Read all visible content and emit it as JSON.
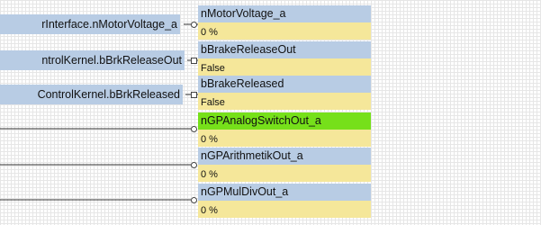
{
  "sources": [
    {
      "label": "rInterface.nMotorVoltage_a",
      "pin": "circle"
    },
    {
      "label": "ntrolKernel.bBrkReleaseOut",
      "pin": "square"
    },
    {
      "label": "ControlKernel.bBrkReleased",
      "pin": "square"
    }
  ],
  "watches": [
    {
      "name": "nMotorVoltage_a",
      "value": "0 %",
      "active": false
    },
    {
      "name": "bBrakeReleaseOut",
      "value": "False",
      "active": false
    },
    {
      "name": "bBrakeReleased",
      "value": "False",
      "active": false
    },
    {
      "name": "nGPAnalogSwitchOut_a",
      "value": "0 %",
      "active": true
    },
    {
      "name": "nGPArithmetikOut_a",
      "value": "0 %",
      "active": false
    },
    {
      "name": "nGPMulDivOut_a",
      "value": "0 %",
      "active": false
    }
  ],
  "colors": {
    "name_bg": "#b8cce4",
    "active_bg": "#76e01a",
    "value_bg": "#f5e79a",
    "wire": "#333333",
    "grid": "#e6e6e6"
  }
}
